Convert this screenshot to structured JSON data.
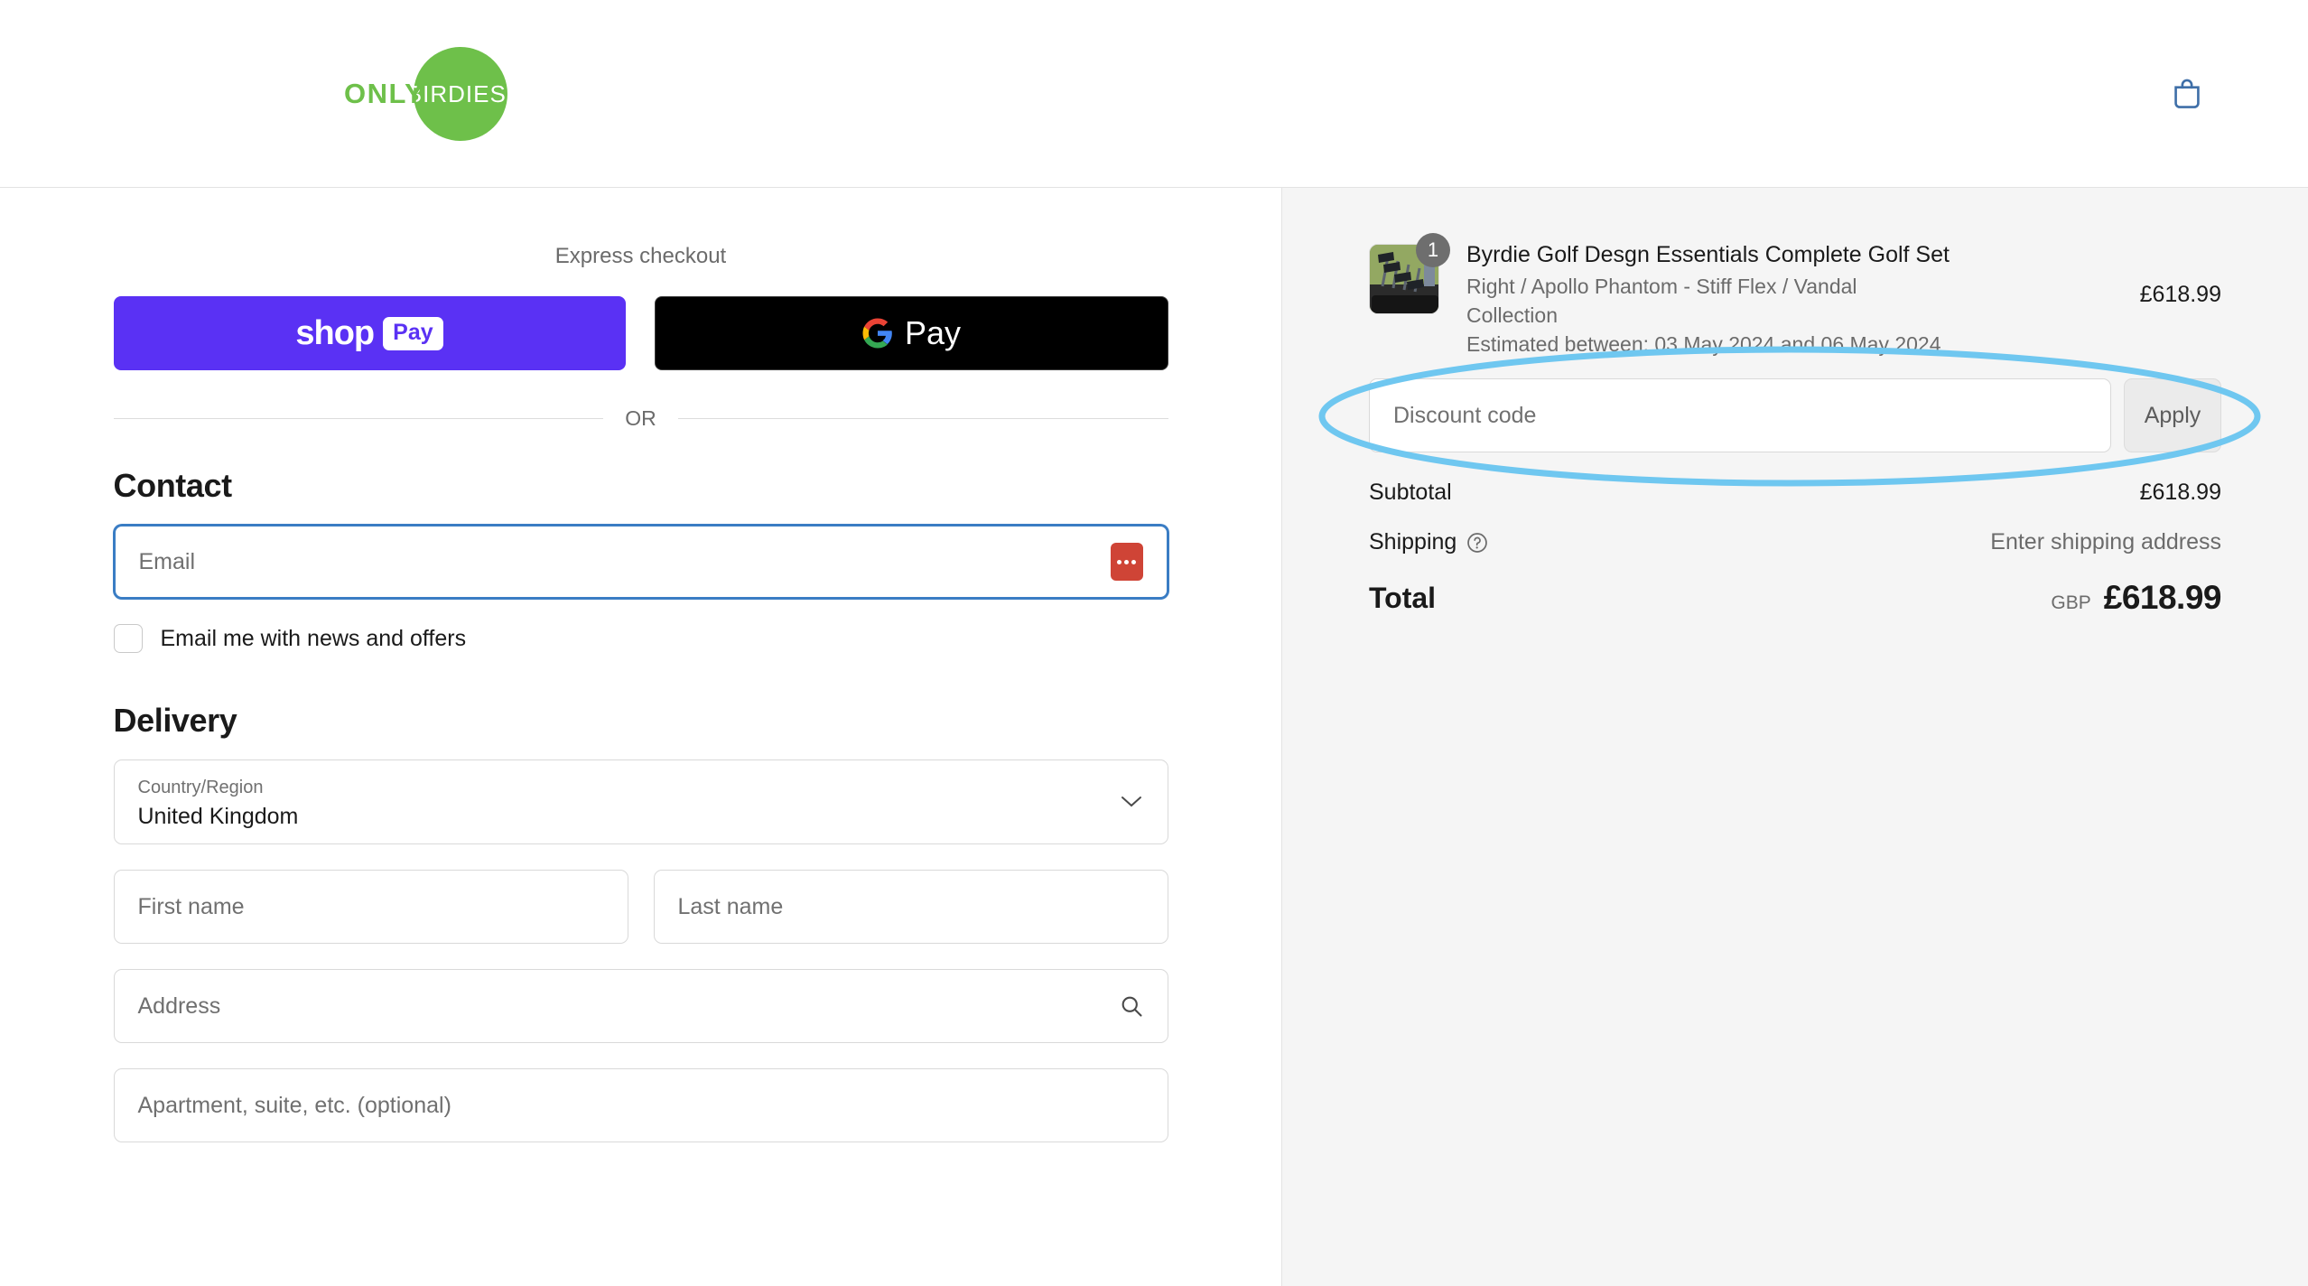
{
  "header": {
    "logo_only": "ONLY",
    "logo_birdies": "BIRDIES",
    "cart_icon": "shopping-bag-icon"
  },
  "express": {
    "label": "Express checkout",
    "shop_pay_word": "shop",
    "shop_pay_badge": "Pay",
    "gpay_word": "Pay",
    "or_text": "OR"
  },
  "contact": {
    "title": "Contact",
    "email_placeholder": "Email",
    "autofill_icon": "dots-icon",
    "newsletter_label": "Email me with news and offers"
  },
  "delivery": {
    "title": "Delivery",
    "country_label": "Country/Region",
    "country_value": "United Kingdom",
    "chevron_icon": "chevron-down-icon",
    "first_name_placeholder": "First name",
    "last_name_placeholder": "Last name",
    "address_placeholder": "Address",
    "address_search_icon": "search-icon",
    "apartment_placeholder": "Apartment, suite, etc. (optional)"
  },
  "summary": {
    "item": {
      "title": "Byrdie Golf Desgn Essentials Complete Golf Set",
      "variant": "Right / Apollo Phantom - Stiff Flex / Vandal Collection",
      "eta": "Estimated between: 03 May 2024 and 06 May 2024",
      "price": "£618.99",
      "quantity": "1"
    },
    "discount_placeholder": "Discount code",
    "apply_label": "Apply",
    "subtotal_label": "Subtotal",
    "subtotal_value": "£618.99",
    "shipping_label": "Shipping",
    "shipping_help_icon": "help-circle-icon",
    "shipping_value": "Enter shipping address",
    "total_label": "Total",
    "total_currency": "GBP",
    "total_amount": "£618.99"
  },
  "annotation": {
    "type": "ellipse-highlight",
    "color": "#6fc7f0",
    "target": "discount-code-row"
  },
  "colors": {
    "brand_green": "#6ec04a",
    "shop_pay_purple": "#5a31f4",
    "focus_blue": "#3a7dc4",
    "panel_grey": "#f5f5f5",
    "highlight_blue": "#6fc7f0"
  }
}
